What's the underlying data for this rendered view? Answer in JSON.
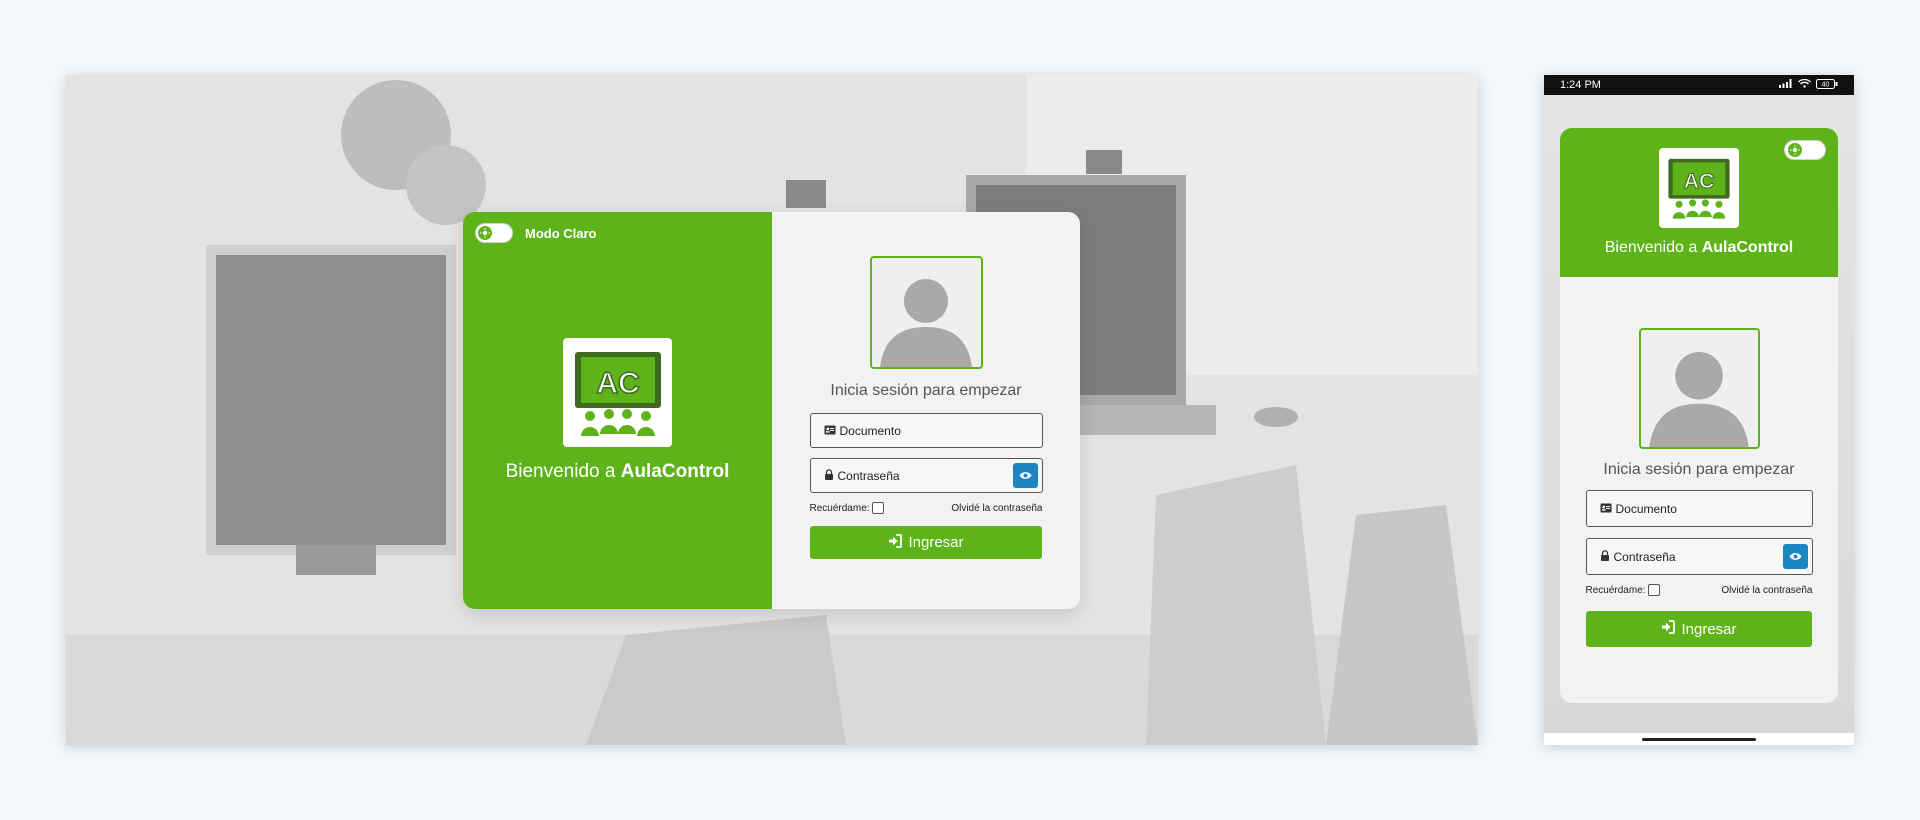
{
  "desktop": {
    "theme_toggle_label": "Modo Claro",
    "welcome_prefix": "Bienvenido a ",
    "brand_name": "AulaControl",
    "logo_text": "AC",
    "subtitle": "Inicia sesión para empezar",
    "document_placeholder": "Documento",
    "password_placeholder": "Contraseña",
    "remember_label": "Recuérdame:",
    "forgot_label": "Olvidé la contraseña",
    "submit_label": "Ingresar"
  },
  "mobile": {
    "status_time": "1:24 PM",
    "battery": "40",
    "welcome_prefix": "Bienvenido a ",
    "brand_name": "AulaControl",
    "logo_text": "AC",
    "subtitle": "Inicia sesión para empezar",
    "document_placeholder": "Documento",
    "password_placeholder": "Contraseña",
    "remember_label": "Recuérdame:",
    "forgot_label": "Olvidé la contraseña",
    "submit_label": "Ingresar"
  },
  "colors": {
    "brand_green": "#5fb31a",
    "eye_button_blue": "#1d86c2",
    "form_background": "#f2f2f2",
    "page_background": "#f5f8fb"
  },
  "icons": {
    "theme": "sun-icon",
    "document": "id-card-icon",
    "password": "lock-icon",
    "reveal": "eye-icon",
    "submit": "sign-in-icon",
    "avatar": "user-silhouette-icon"
  }
}
